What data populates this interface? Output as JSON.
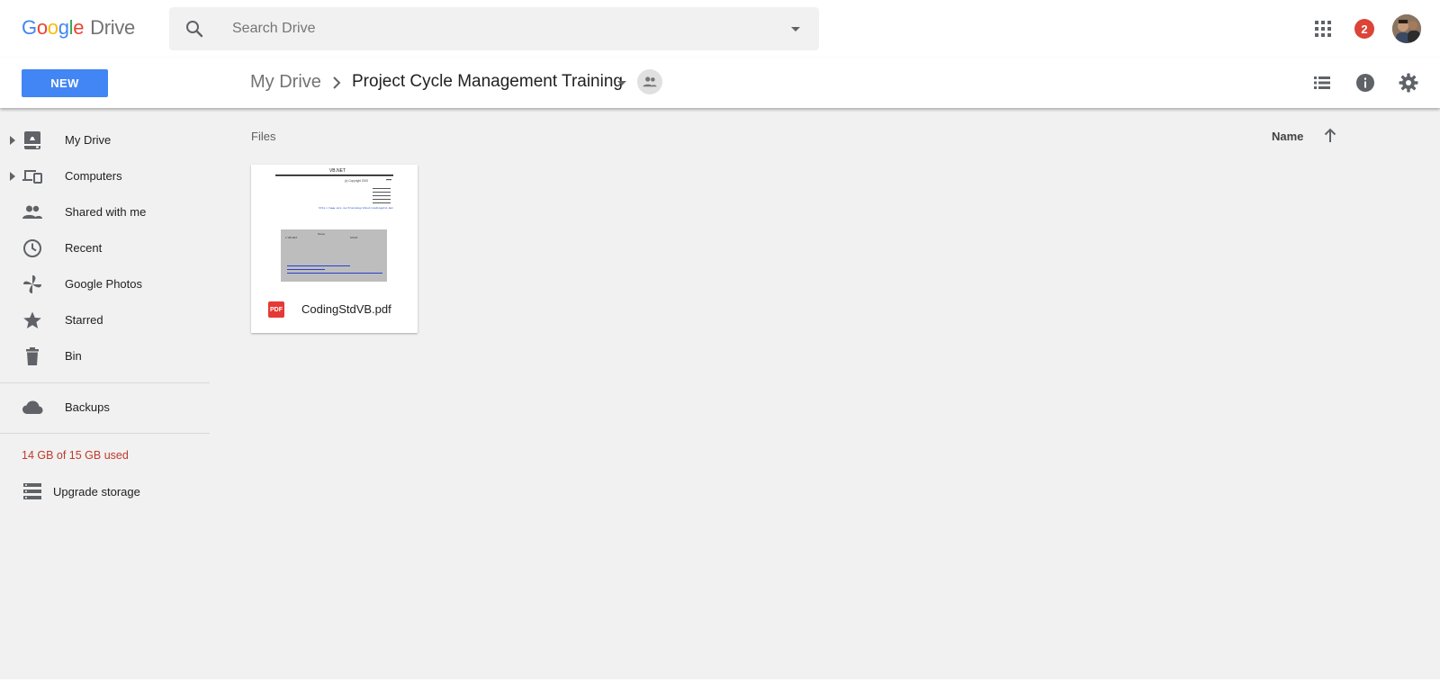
{
  "header": {
    "logo_parts": [
      "G",
      "o",
      "o",
      "g",
      "l",
      "e"
    ],
    "product": "Drive",
    "search_placeholder": "Search Drive",
    "notifications_count": "2"
  },
  "toolbar": {
    "new_label": "NEW",
    "breadcrumb_root": "My Drive",
    "breadcrumb_current": "Project Cycle Management Training"
  },
  "sidebar": {
    "items": [
      {
        "label": "My Drive",
        "icon": "my-drive-icon",
        "expandable": true
      },
      {
        "label": "Computers",
        "icon": "computers-icon",
        "expandable": true
      },
      {
        "label": "Shared with me",
        "icon": "people-icon",
        "expandable": false
      },
      {
        "label": "Recent",
        "icon": "clock-icon",
        "expandable": false
      },
      {
        "label": "Google Photos",
        "icon": "pinwheel-icon",
        "expandable": false
      },
      {
        "label": "Starred",
        "icon": "star-icon",
        "expandable": false
      },
      {
        "label": "Bin",
        "icon": "trash-icon",
        "expandable": false
      }
    ],
    "backups_label": "Backups",
    "storage_text": "14 GB of 15 GB used",
    "upgrade_label": "Upgrade storage"
  },
  "main": {
    "section_heading": "Files",
    "sort_label": "Name",
    "files": [
      {
        "name": "CodingStdVB.pdf",
        "type_badge": "PDF",
        "thumbnail": {
          "title": "VB.NET",
          "copyright": "(c) Copyright 2000",
          "link": "http://www.mcs.ie/training/vbnet/codingstd.doc",
          "box_left": "1 VB.NET",
          "box_mid": "Name",
          "box_right": "6/2/20"
        }
      }
    ]
  },
  "colors": {
    "accent": "#4285f4",
    "badge": "#db4437",
    "storage_warning": "#c0392b",
    "pdf_red": "#e53935"
  }
}
